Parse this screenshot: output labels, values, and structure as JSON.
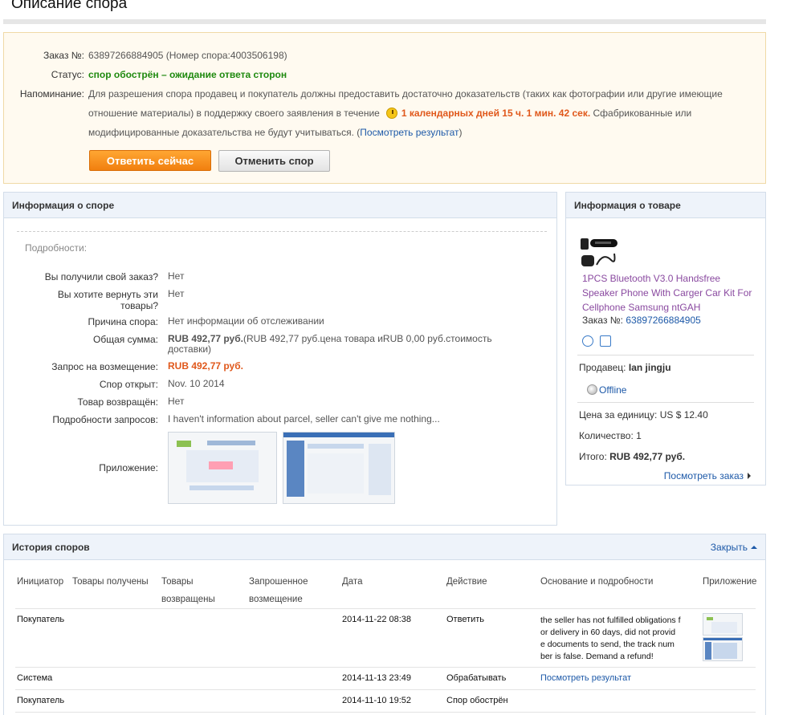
{
  "page": {
    "title": "Описание спора"
  },
  "summary": {
    "order_label": "Заказ №:",
    "order_value": "63897266884905 (Номер спора:4003506198)",
    "status_label": "Статус:",
    "status_value": "спор обострён – ожидание ответа сторон",
    "reminder_label": "Напоминание:",
    "reminder_line1": "Для разрешения спора продавец и покупатель должны предоставить достаточно доказательств (таких как фотографии или другие имеющие",
    "reminder_line2_start": "отношение материалы) в поддержку своего заявления в течение",
    "reminder_timer": "1 календарных дней 15 ч. 1 мин. 42 сек.",
    "reminder_line2_end": "Сфабрикованные или",
    "reminder_line3": "модифицированные доказательства не будут учитываться. (",
    "reminder_link": "Посмотреть результат",
    "reminder_close": ")",
    "reply_button": "Ответить сейчас",
    "cancel_button": "Отменить спор"
  },
  "dispute": {
    "header": "Информация о споре",
    "details_label": "Подробности:",
    "received_label": "Вы получили свой заказ?",
    "received_value": "Нет",
    "return_label": "Вы хотите вернуть эти товары?",
    "return_value": "Нет",
    "reason_label": "Причина спора:",
    "reason_value": "Нет информации об отслеживании",
    "total_label": "Общая сумма:",
    "total_value_bold": "RUB 492,77 руб.",
    "total_value_rest": "(RUB 492,77 руб.цена товара иRUB 0,00 руб.стоимость доставки)",
    "refund_label": "Запрос на возмещение:",
    "refund_value": "RUB 492,77 руб.",
    "opened_label": "Спор открыт:",
    "opened_value": "Nov. 10 2014",
    "returned_label": "Товар возвращён:",
    "returned_value": "Нет",
    "request_details_label": "Подробности запросов:",
    "request_details_value": "I haven't information about parcel, seller can't give me nothing...",
    "attachment_label": "Приложение:"
  },
  "product": {
    "header": "Информация о товаре",
    "name": "1PCS Bluetooth V3.0 Handsfree Speaker Phone With Carger Car Kit For Cellphone Samsung ntGAH",
    "order_label": "Заказ №:",
    "order_number": "63897266884905",
    "seller_label": "Продавец:",
    "seller_name": "Ian jingju",
    "seller_status": "Offline",
    "unit_price_label": "Цена за единицу:",
    "unit_price": "US $ 12.40",
    "quantity_label": "Количество:",
    "quantity": "1",
    "total_label": "Итого:",
    "total": "RUB 492,77 руб.",
    "view_order": "Посмотреть заказ"
  },
  "history": {
    "header": "История споров",
    "close_link": "Закрыть",
    "columns": {
      "initiator": "Инициатор",
      "goods_received": "Товары получены",
      "goods_returned_1": "Товары",
      "goods_returned_2": "возвращены",
      "refund_1": "Запрошенное",
      "refund_2": "возмещение",
      "date": "Дата",
      "action": "Действие",
      "reason": "Основание и подробности",
      "attachment": "Приложение"
    },
    "rows": [
      {
        "initiator": "Покупатель",
        "date": "2014-11-22 08:38",
        "action": "Ответить",
        "reason_lines": [
          "the seller has not fulfilled obligations f",
          "or delivery in 60 days, did not provid",
          "e documents to send, the track num",
          "ber is false. Demand a refund!"
        ]
      },
      {
        "initiator": "Система",
        "date": "2014-11-13 23:49",
        "action": "Обрабатывать",
        "reason_link": "Посмотреть результат"
      },
      {
        "initiator": "Покупатель",
        "date": "2014-11-10 19:52",
        "action": "Спор обострён"
      }
    ]
  }
}
